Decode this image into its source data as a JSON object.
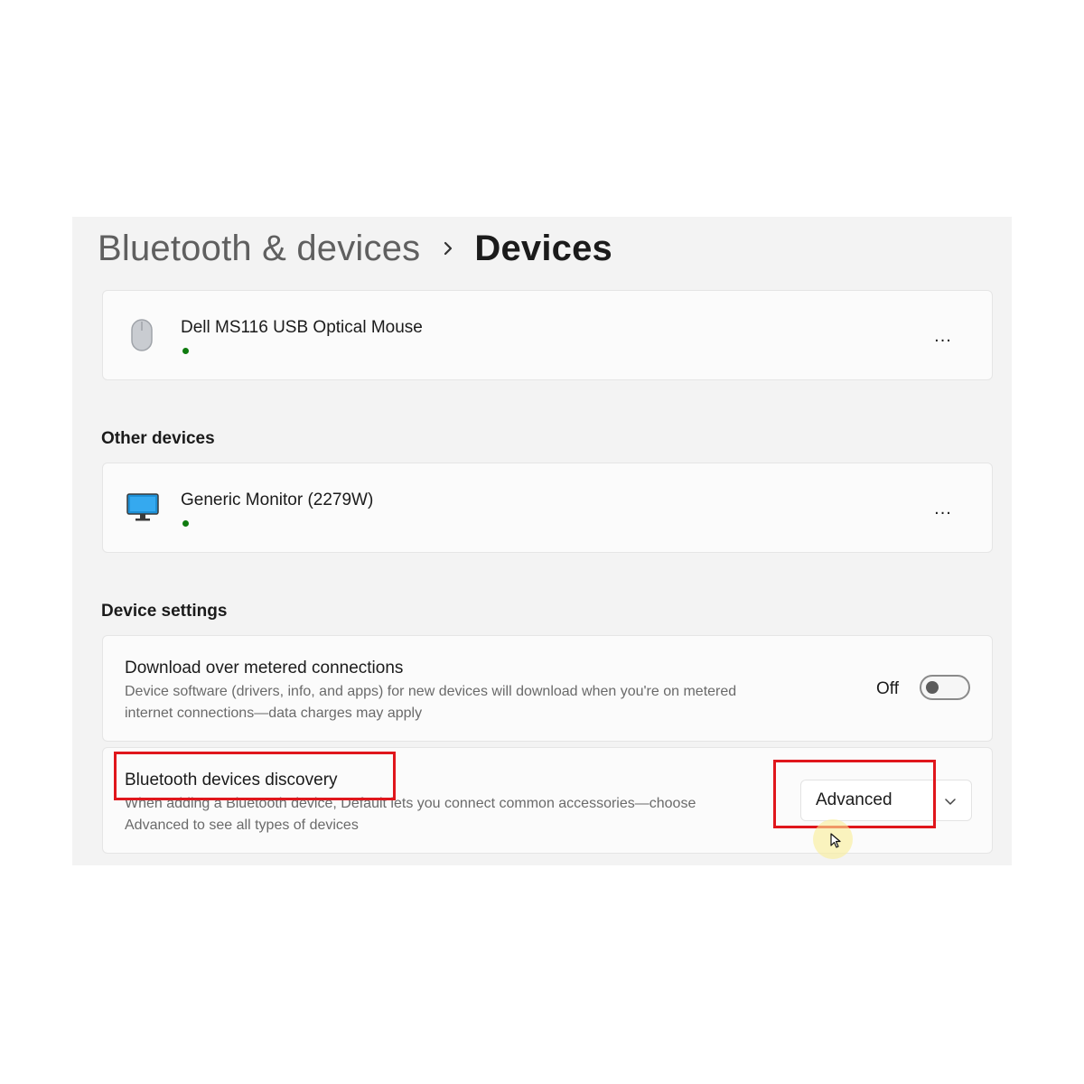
{
  "breadcrumb": {
    "parent": "Bluetooth & devices",
    "current": "Devices"
  },
  "devices": [
    {
      "name": "Dell MS116 USB Optical Mouse",
      "icon": "mouse-icon",
      "status_color": "#0f7b0f",
      "more_label": "..."
    }
  ],
  "other_devices": {
    "title": "Other devices",
    "items": [
      {
        "name": "Generic Monitor (2279W)",
        "icon": "monitor-icon",
        "status_color": "#0f7b0f",
        "more_label": "..."
      }
    ]
  },
  "device_settings": {
    "title": "Device settings",
    "metered": {
      "title": "Download over metered connections",
      "desc_line1": "Device software (drivers, info, and apps) for new devices will download when you're on metered",
      "desc_line2": "internet connections—data charges may apply",
      "toggle_label": "Off",
      "toggle_on": false
    },
    "discovery": {
      "title": "Bluetooth devices discovery",
      "desc_line1": "When adding a Bluetooth device, Default lets you connect common accessories—choose",
      "desc_line2": "Advanced to see all types of devices",
      "selected": "Advanced"
    }
  },
  "colors": {
    "highlight": "#e0161c",
    "status_connected": "#0f7b0f",
    "window_bg": "#f3f3f3"
  }
}
